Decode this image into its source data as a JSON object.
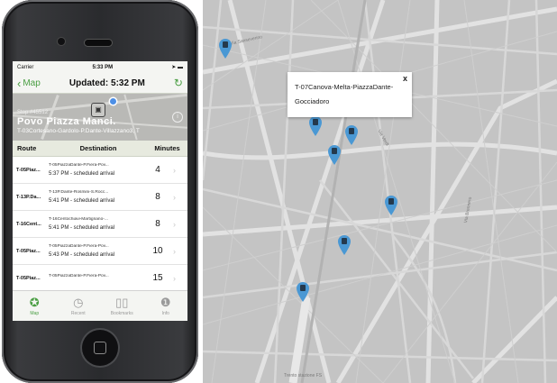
{
  "status": {
    "carrier": "Carrier",
    "time": "5:33 PM"
  },
  "nav": {
    "back_label": "Map",
    "title": "Updated: 5:32 PM"
  },
  "stop": {
    "number": "Stop #45512",
    "name": "Povo  Piazza Manci.",
    "routes": "T-03Cortesano-Gardolo-P.Dante-Villazzano3, T"
  },
  "table": {
    "headers": {
      "route": "Route",
      "destination": "Destination",
      "minutes": "Minutes"
    },
    "rows": [
      {
        "route": "T-05Piaz...",
        "dest": "T-05PiazzaDante-P.Fiera-Pov...",
        "arrival": "5:37 PM - scheduled arrival",
        "minutes": "4"
      },
      {
        "route": "T-13P.Da...",
        "dest": "T-13P.Dante-Rosmini-S.Rocc...",
        "arrival": "5:41 PM - scheduled arrival",
        "minutes": "8"
      },
      {
        "route": "T-16Cent...",
        "dest": "T-16Centochiavi-Martignano-...",
        "arrival": "5:41 PM - scheduled arrival",
        "minutes": "8"
      },
      {
        "route": "T-05Piaz...",
        "dest": "T-05PiazzaDante-P.Fiera-Pov...",
        "arrival": "5:43 PM - scheduled arrival",
        "minutes": "10"
      },
      {
        "route": "T-05Piaz...",
        "dest": "T-05PiazzaDante-P.Fiera-Pov...",
        "arrival": "",
        "minutes": "15"
      }
    ]
  },
  "tabs": [
    {
      "label": "Map",
      "icon": "map-icon"
    },
    {
      "label": "Recent",
      "icon": "clock-icon"
    },
    {
      "label": "Bookmarks",
      "icon": "book-icon"
    },
    {
      "label": "Info",
      "icon": "info-icon"
    }
  ],
  "map": {
    "popup_text": "T-07Canova-Melta-PiazzaDante-Gocciadoro",
    "close": "x",
    "labels": [
      "Via Sanseverino",
      "Via Brennero",
      "Trento stazione FS",
      "Via Verdi"
    ]
  },
  "colors": {
    "accent": "#4a9e43",
    "pin": "#4a98d4",
    "map_bg": "#c4c4c4"
  }
}
